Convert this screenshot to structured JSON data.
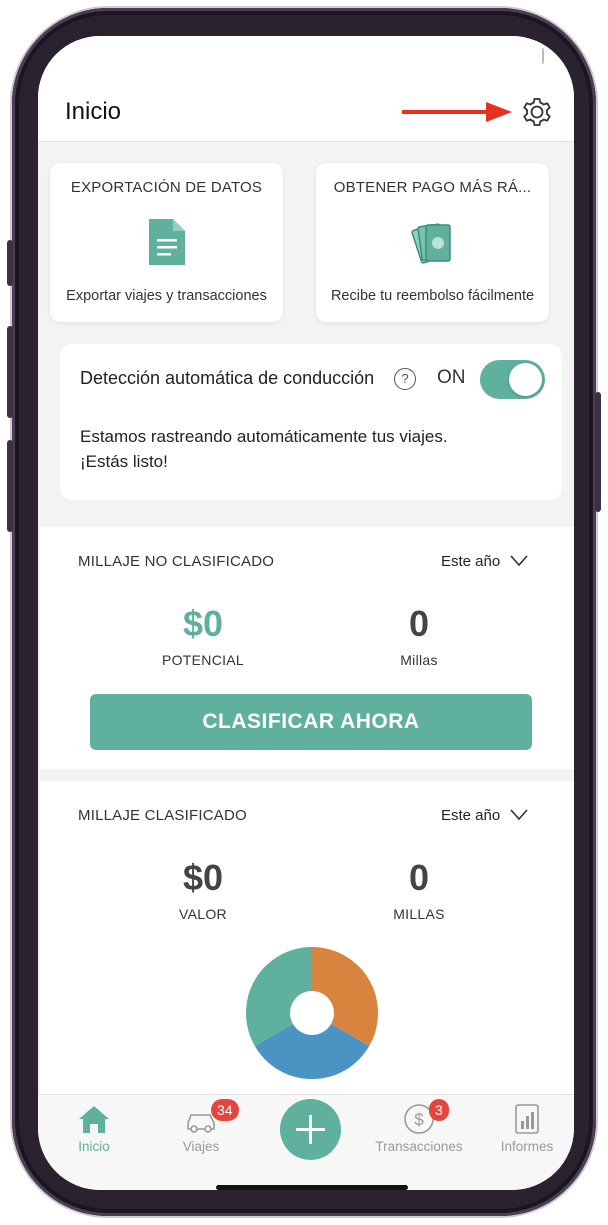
{
  "header": {
    "title": "Inicio"
  },
  "cards": [
    {
      "title": "EXPORTACIÓN DE DATOS",
      "subtitle": "Exportar viajes y transacciones",
      "icon": "document-icon"
    },
    {
      "title": "OBTENER PAGO MÁS RÁ...",
      "subtitle": "Recibe tu reembolso fácilmente",
      "icon": "cash-icon"
    }
  ],
  "auto_detection": {
    "title": "Detección automática de conducción",
    "help": "?",
    "state_label": "ON",
    "enabled": true,
    "description": "Estamos rastreando automáticamente tus viajes. ¡Estás listo!"
  },
  "unclassified": {
    "title": "MILLAJE NO CLASIFICADO",
    "period": "Este año",
    "potential_value": "$0",
    "potential_label": "POTENCIAL",
    "miles_value": "0",
    "miles_label": "Millas",
    "button": "CLASIFICAR AHORA"
  },
  "classified": {
    "title": "MILLAJE CLASIFICADO",
    "period": "Este año",
    "value": "$0",
    "value_label": "VALOR",
    "miles_value": "0",
    "miles_label": "MILLAS"
  },
  "nav": {
    "items": [
      {
        "label": "Inicio",
        "icon": "home-icon",
        "active": true
      },
      {
        "label": "Viajes",
        "icon": "car-icon",
        "badge": "34"
      },
      {
        "label": "Transacciones",
        "icon": "dollar-icon",
        "badge": "3"
      },
      {
        "label": "Informes",
        "icon": "report-icon"
      }
    ],
    "fab_icon": "plus-icon"
  },
  "colors": {
    "accent": "#5fb09c",
    "badge": "#e6453f",
    "arrow": "#e8301f",
    "pie_orange": "#d8843f",
    "pie_blue": "#4a93c2",
    "pie_green": "#5fb09c"
  }
}
